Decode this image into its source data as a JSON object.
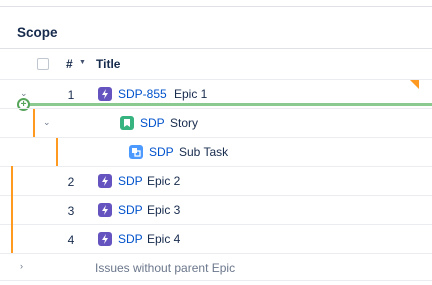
{
  "section": {
    "title": "Scope"
  },
  "header": {
    "rank_label": "#",
    "title_label": "Title"
  },
  "rows": [
    {
      "rank": "1",
      "key": "SDP-855",
      "summary": "Epic 1",
      "type_icon": "epic-icon"
    },
    {
      "rank": "",
      "key": "SDP",
      "summary": "Story",
      "type_icon": "story-icon"
    },
    {
      "rank": "",
      "key": "SDP",
      "summary": "Sub Task",
      "type_icon": "subtask-icon"
    },
    {
      "rank": "2",
      "key": "SDP",
      "summary": "Epic 2",
      "type_icon": "epic-icon"
    },
    {
      "rank": "3",
      "key": "SDP",
      "summary": "Epic 3",
      "type_icon": "epic-icon"
    },
    {
      "rank": "4",
      "key": "SDP",
      "summary": "Epic 4",
      "type_icon": "epic-icon"
    }
  ],
  "footer": {
    "label": "Issues without parent Epic"
  },
  "colors": {
    "epic": "#6554c0",
    "story": "#36b37e",
    "subtask": "#4c9aff",
    "accent": "#ff991f",
    "drop_line": "#8ac98f",
    "link": "#0052cc"
  }
}
